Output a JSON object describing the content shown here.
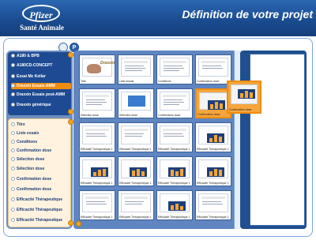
{
  "header": {
    "logo_text": "Pfizer",
    "logo_subtitle": "Santé Animale",
    "title": "Définition de votre projet"
  },
  "toolbar": {
    "p_button_label": "P"
  },
  "left_nav": {
    "section1": [
      {
        "label": "A180 & BPB",
        "active": false
      },
      {
        "label": "A180CD-CONCEPT",
        "active": false
      },
      {
        "label": "Essai Mc Kellar",
        "active": false
      },
      {
        "label": "Draxxin Essais AMM",
        "active": true
      },
      {
        "label": "Draxxin Essais post-AMM",
        "active": false
      },
      {
        "label": "Draxxin générique",
        "active": false
      }
    ],
    "section2": [
      {
        "label": "Titre"
      },
      {
        "label": "Liste essais"
      },
      {
        "label": "Conditions"
      },
      {
        "label": "Confirmation dose"
      },
      {
        "label": "Sélection dose"
      },
      {
        "label": "Sélection dose"
      },
      {
        "label": "Confirmation dose"
      },
      {
        "label": "Confirmation dose"
      },
      {
        "label": "Efficacité Thérapeutique"
      },
      {
        "label": "Efficacité Thérapeutique"
      },
      {
        "label": "Efficacité Thérapeutique"
      }
    ]
  },
  "slides": {
    "row1": [
      {
        "caption": "Titre",
        "thumb_title": "Draxxin"
      },
      {
        "caption": "Liste essais"
      },
      {
        "caption": "Conditions"
      },
      {
        "caption": "Confirmation dose"
      }
    ],
    "row2": [
      {
        "caption": "Sélection dose"
      },
      {
        "caption": "Sélection dose"
      },
      {
        "caption": "Confirmation dose"
      },
      {
        "caption": "Confirmation dose",
        "selected": true
      }
    ],
    "row3": [
      {
        "caption": "Efficacité Thérapeutique 1"
      },
      {
        "caption": "Efficacité Thérapeutique 1"
      },
      {
        "caption": "Efficacité Thérapeutique 1"
      },
      {
        "caption": "Efficacité Thérapeutique 1"
      }
    ],
    "row4": [
      {
        "caption": "Efficacité Thérapeutique 1"
      },
      {
        "caption": "Efficacité Thérapeutique 1"
      },
      {
        "caption": "Efficacité Thérapeutique 1"
      },
      {
        "caption": "Efficacité Thérapeutique 1"
      }
    ],
    "row5": [
      {
        "caption": "Efficacité Thérapeutique 1"
      },
      {
        "caption": "Efficacité Thérapeutique 1"
      },
      {
        "caption": "Efficacité Thérapeutique 1"
      },
      {
        "caption": "Efficacité Thérapeutique 1"
      }
    ]
  },
  "floating_slide": {
    "caption": "Confirmation dose"
  },
  "colors": {
    "header_blue": "#1a4a8e",
    "accent_orange": "#f08c10",
    "nav_dark": "#1d4a92",
    "nav_light": "#fff3df"
  }
}
